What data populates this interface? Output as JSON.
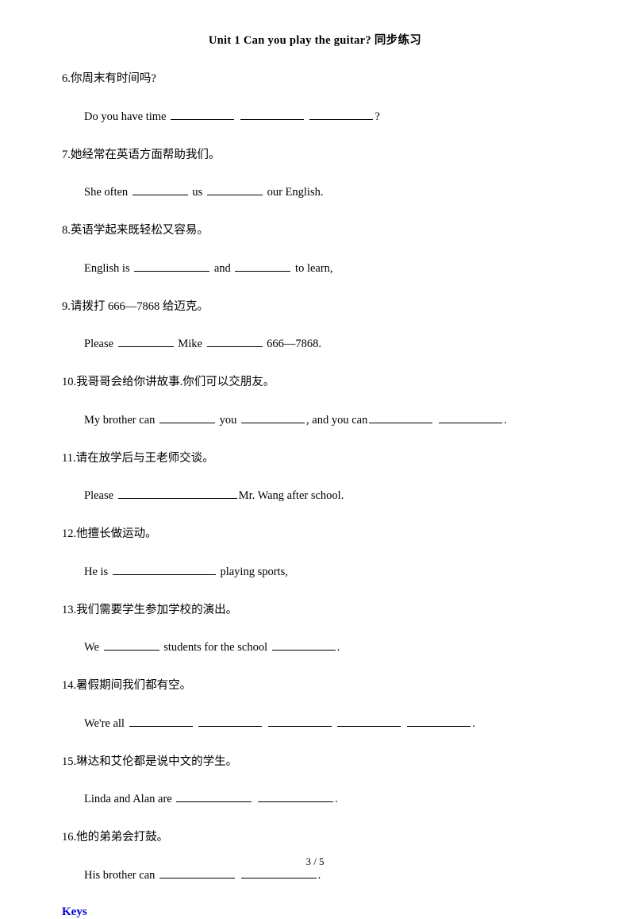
{
  "header": "Unit 1 Can you play the guitar?  同步练习",
  "q6": {
    "cn": "6.你周末有时间吗?",
    "en_a": "Do you have time ",
    "en_b": "?"
  },
  "q7": {
    "cn": "7.她经常在英语方面帮助我们。",
    "en_a": "She often ",
    "en_b": " us ",
    "en_c": " our English."
  },
  "q8": {
    "cn": "8.英语学起来既轻松又容易。",
    "en_a": "English is ",
    "en_b": " and ",
    "en_c": " to learn,"
  },
  "q9": {
    "cn": "9.请拨打 666—7868 给迈克。",
    "en_a": "Please ",
    "en_b": " Mike ",
    "en_c": " 666—7868."
  },
  "q10": {
    "cn": "10.我哥哥会给你讲故事.你们可以交朋友。",
    "en_a": "My brother can ",
    "en_b": " you ",
    "en_c": ", and you can",
    "en_d": "."
  },
  "q11": {
    "cn": "11.请在放学后与王老师交谈。",
    "en_a": "Please ",
    "en_b": "Mr. Wang after school."
  },
  "q12": {
    "cn": "12.他擅长做运动。",
    "en_a": "He is ",
    "en_b": " playing sports,"
  },
  "q13": {
    "cn": "13.我们需要学生参加学校的演出。",
    "en_a": "We ",
    "en_b": " students for the school ",
    "en_c": "."
  },
  "q14": {
    "cn": "14.暑假期间我们都有空。",
    "en_a": "We're all ",
    "en_b": "."
  },
  "q15": {
    "cn": "15.琳达和艾伦都是说中文的学生。",
    "en_a": "Linda and Alan are ",
    "en_b": "."
  },
  "q16": {
    "cn": "16.他的弟弟会打鼓。",
    "en_a": "His brother can ",
    "en_b": "."
  },
  "keys": "Keys",
  "footer": "3 / 5"
}
